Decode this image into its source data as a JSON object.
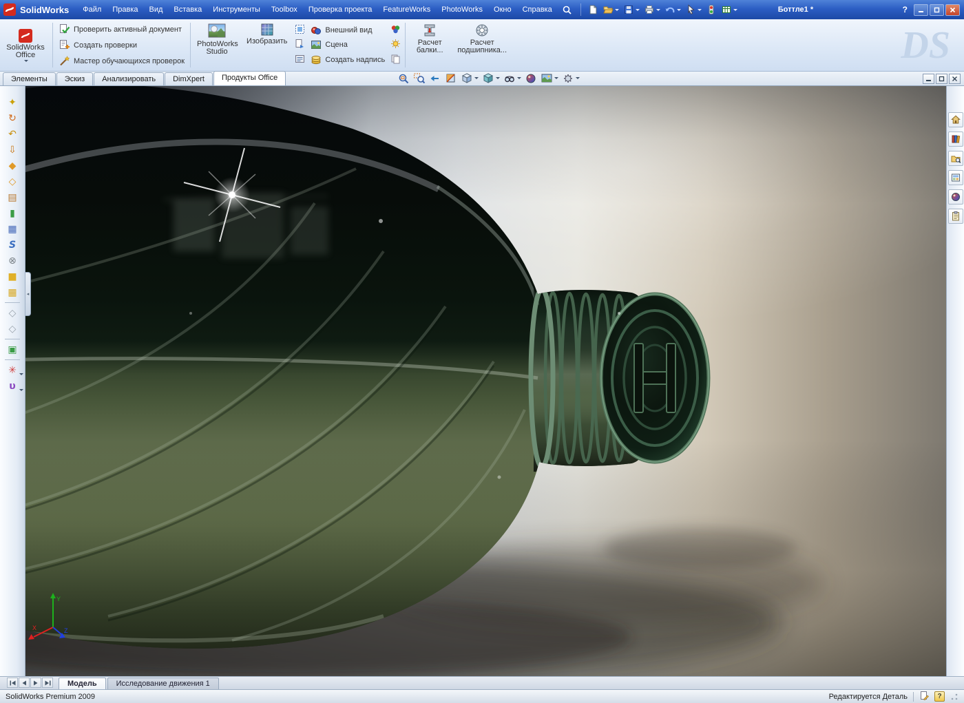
{
  "titlebar": {
    "app_name": "SolidWorks",
    "menus": [
      "Файл",
      "Правка",
      "Вид",
      "Вставка",
      "Инструменты",
      "Toolbox",
      "Проверка проекта",
      "FeatureWorks",
      "PhotoWorks",
      "Окно",
      "Справка"
    ],
    "document_name": "Боттле1 *",
    "help_label": "?",
    "quick_icons": [
      "new-document",
      "open",
      "save",
      "print",
      "undo",
      "select-pointer",
      "rebuild-traffic-light",
      "design-table"
    ]
  },
  "ribbon": {
    "office_button_label": "SolidWorks Office",
    "check_actions": [
      "Проверить активный документ",
      "Создать проверки",
      "Мастер обучающихся проверок"
    ],
    "photoworks_studio_label": "PhotoWorks Studio",
    "render_label": "Изобразить",
    "appearance_label": "Внешний вид",
    "scene_label": "Сцена",
    "decal_label": "Создать надпись",
    "beam_calc_label": "Расчет балки...",
    "bearing_calc_label": "Расчет подшипника...",
    "watermark": "DS"
  },
  "command_tabs": {
    "items": [
      "Элементы",
      "Эскиз",
      "Анализировать",
      "DimXpert",
      "Продукты Office"
    ],
    "active": "Продукты Office"
  },
  "hud_toolbar_icons": [
    "zoom-to-fit",
    "zoom-to-area",
    "previous-view",
    "section-view",
    "view-orientation",
    "display-style",
    "hide-show-items",
    "edit-appearance",
    "apply-scene",
    "view-settings"
  ],
  "left_toolbar_icons": [
    "compass-tool",
    "rotate-tool",
    "undo-curve-tool",
    "arrow-down-tool",
    "diamond-filled-tool",
    "diamond-outline-tool",
    "panel-tool",
    "green-block-tool",
    "blue-grid-tool",
    "spline-tool",
    "sphere-x-tool",
    "yellow-box-tool",
    "yellow-grid-tool",
    "gray-diamond-tool-a",
    "gray-diamond-tool-b",
    "edit-board-tool",
    "asterisk-menu-tool",
    "u-spline-menu-tool"
  ],
  "task_pane_icons": [
    "solidworks-resources",
    "design-library",
    "file-explorer",
    "view-palette",
    "appearances-scenes",
    "custom-properties"
  ],
  "motion_nav_icons": [
    "scroll-first",
    "scroll-previous",
    "scroll-next",
    "scroll-last"
  ],
  "viewport": {
    "triad": {
      "x_label": "X",
      "y_label": "Y",
      "z_label": "Z"
    }
  },
  "motion_bar": {
    "tabs": [
      "Модель",
      "Исследование движения 1"
    ],
    "active": "Модель"
  },
  "status_bar": {
    "left_text": "SolidWorks Premium 2009",
    "right_text": "Редактируется Деталь",
    "help_badge": "?"
  },
  "colors": {
    "titlebar_blue": "#2e5ec2",
    "ribbon_background": "#dde9f7",
    "bottle_dark_green": "#0c1810",
    "bottle_moss_green": "#4e5c42",
    "backdrop_warm_gray": "#d2c9b8",
    "active_tab_white": "#ffffff",
    "watermark_blue": "#c3d4e9"
  }
}
